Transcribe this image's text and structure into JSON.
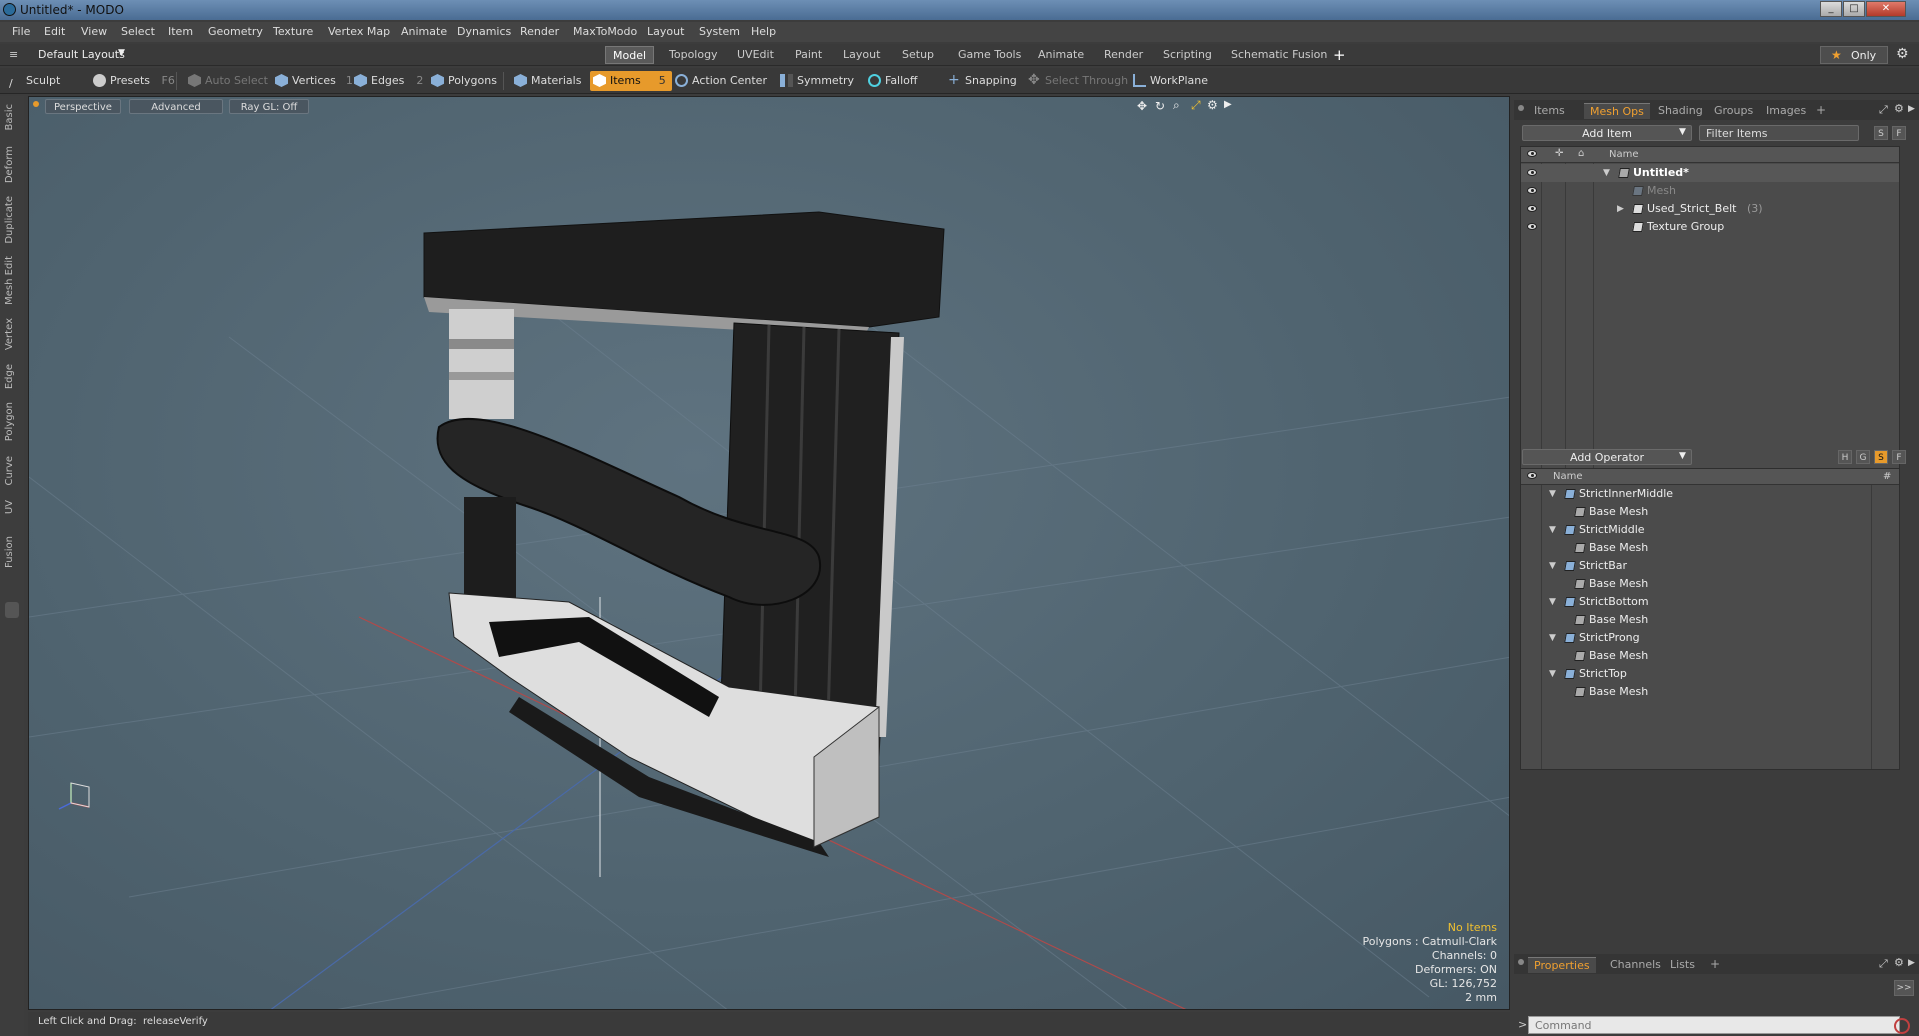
{
  "window": {
    "title": "Untitled* - MODO"
  },
  "menu": [
    "File",
    "Edit",
    "View",
    "Select",
    "Item",
    "Geometry",
    "Texture",
    "Vertex Map",
    "Animate",
    "Dynamics",
    "Render",
    "MaxToModo",
    "Layout",
    "System",
    "Help"
  ],
  "layouts": {
    "default_label": "Default Layouts",
    "tabs": [
      "Model",
      "Topology",
      "UVEdit",
      "Paint",
      "Layout",
      "Setup",
      "Game Tools",
      "Animate",
      "Render",
      "Scripting",
      "Schematic Fusion"
    ],
    "active": "Model",
    "only_label": "Only"
  },
  "toolbar": {
    "sculpt": "Sculpt",
    "presets": "Presets",
    "presets_key": "F6",
    "auto_select": "Auto Select",
    "vertices": "Vertices",
    "vertices_count": "1",
    "edges": "Edges",
    "edges_count": "2",
    "polygons": "Polygons",
    "materials": "Materials",
    "items": "Items",
    "items_count": "5",
    "action_center": "Action Center",
    "symmetry": "Symmetry",
    "falloff": "Falloff",
    "snapping": "Snapping",
    "select_through": "Select Through",
    "workplane": "WorkPlane"
  },
  "left_tabs": [
    "Basic",
    "Deform",
    "Duplicate",
    "Mesh Edit",
    "Vertex",
    "Edge",
    "Polygon",
    "Curve",
    "UV",
    "Fusion"
  ],
  "viewport": {
    "perspective": "Perspective",
    "advanced": "Advanced",
    "raygl": "Ray GL: Off",
    "info": {
      "no_items": "No Items",
      "polygons": "Polygons : Catmull-Clark",
      "channels": "Channels: 0",
      "deformers": "Deformers: ON",
      "gl": "GL: 126,752",
      "scale": "2 mm"
    }
  },
  "status": {
    "hint_label": "Left Click and Drag:",
    "hint_value": "releaseVerify"
  },
  "items_panel": {
    "tabs": [
      "Items",
      "Mesh Ops",
      "Shading",
      "Groups",
      "Images"
    ],
    "active_tab": "Mesh Ops",
    "add_item": "Add Item",
    "filter_placeholder": "Filter Items",
    "col_name": "Name",
    "rows": [
      {
        "label": "Untitled*"
      },
      {
        "label": "Mesh"
      },
      {
        "label": "Used_Strict_Belt",
        "count": "(3)"
      },
      {
        "label": "Texture Group"
      }
    ]
  },
  "ops_panel": {
    "add_operator": "Add Operator",
    "col_name": "Name",
    "col_hash": "#",
    "groups": [
      {
        "name": "StrictInnerMiddle",
        "child": "Base Mesh"
      },
      {
        "name": "StrictMiddle",
        "child": "Base Mesh"
      },
      {
        "name": "StrictBar",
        "child": "Base Mesh"
      },
      {
        "name": "StrictBottom",
        "child": "Base Mesh"
      },
      {
        "name": "StrictProng",
        "child": "Base Mesh"
      },
      {
        "name": "StrictTop",
        "child": "Base Mesh"
      }
    ]
  },
  "bottom_panel": {
    "tabs": [
      "Properties",
      "Channels",
      "Lists"
    ],
    "active_tab": "Properties",
    "command_placeholder": "Command"
  },
  "colors": {
    "accent": "#e79a2b",
    "viewport_bg": "#56697a"
  }
}
